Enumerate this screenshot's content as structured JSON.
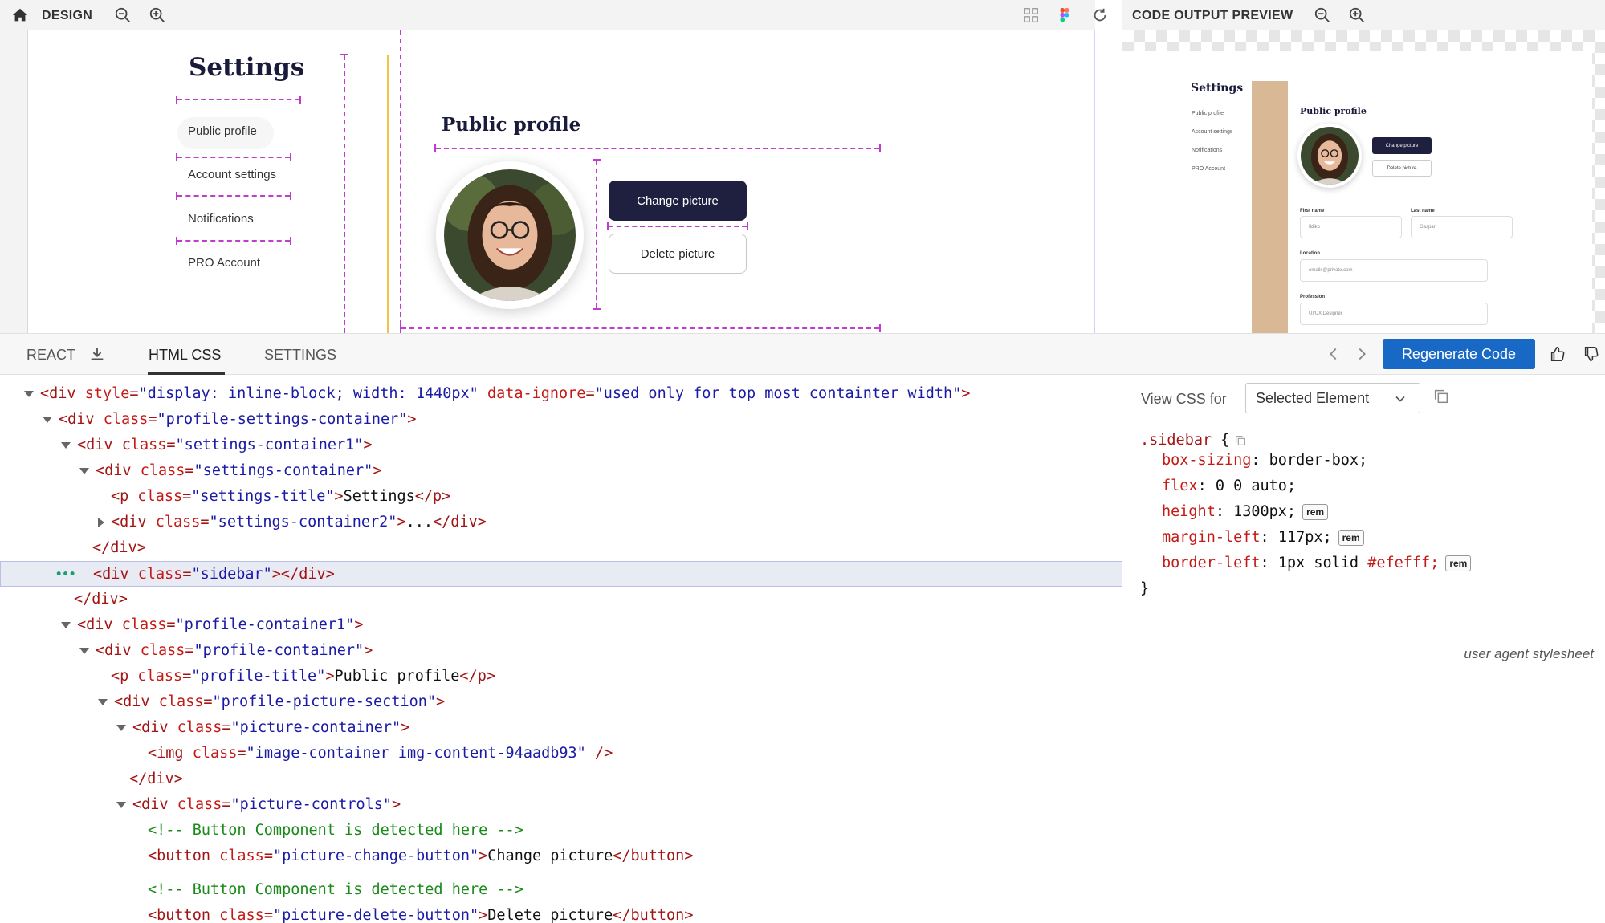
{
  "design_bar": {
    "label": "DESIGN"
  },
  "preview_bar": {
    "label": "CODE OUTPUT PREVIEW"
  },
  "canvas": {
    "settings_title": "Settings",
    "nav": [
      "Public profile",
      "Account settings",
      "Notifications",
      "PRO Account"
    ],
    "profile_title": "Public profile",
    "change_button": "Change picture",
    "delete_button": "Delete picture",
    "accent_line_color": "#f5c242",
    "guide_color": "#c03ccd",
    "button_primary_color": "#1f1f3f"
  },
  "preview": {
    "settings_title": "Settings",
    "nav": [
      "Public profile",
      "Account settings",
      "Notifications",
      "PRO Account"
    ],
    "profile_title": "Public profile",
    "change_button": "Change picture",
    "delete_button": "Delete picture",
    "first_name_label": "First name",
    "first_name_value": "Ildiko",
    "last_name_label": "Last name",
    "last_name_value": "Gaspar",
    "location_label": "Location",
    "location_value": "emails@private.com",
    "profession_label": "Profession",
    "profession_value": "UI/UX Designer",
    "sidebar_color": "#d8b895"
  },
  "tabs": {
    "react": "REACT",
    "html_css": "HTML CSS",
    "settings": "SETTINGS",
    "regenerate": "Regenerate Code",
    "regenerate_color": "#1868c6"
  },
  "code_lines": [
    {
      "indent": 0,
      "tri": "down",
      "parts": [
        [
          "tag",
          "<div "
        ],
        [
          "attr",
          "style"
        ],
        [
          "sym",
          "="
        ],
        [
          "val",
          "\"display: inline-block; width: 1440px\""
        ],
        [
          "txt",
          " "
        ],
        [
          "attr",
          "data-ignore"
        ],
        [
          "sym",
          "="
        ],
        [
          "val",
          "\"used only for top most containter width\""
        ],
        [
          "tag",
          ">"
        ]
      ]
    },
    {
      "indent": 1,
      "tri": "down",
      "parts": [
        [
          "tag",
          "<div "
        ],
        [
          "attr",
          "class"
        ],
        [
          "sym",
          "="
        ],
        [
          "val",
          "\"profile-settings-container\""
        ],
        [
          "tag",
          ">"
        ]
      ]
    },
    {
      "indent": 2,
      "tri": "down",
      "parts": [
        [
          "tag",
          "<div "
        ],
        [
          "attr",
          "class"
        ],
        [
          "sym",
          "="
        ],
        [
          "val",
          "\"settings-container1\""
        ],
        [
          "tag",
          ">"
        ]
      ]
    },
    {
      "indent": 3,
      "tri": "down",
      "parts": [
        [
          "tag",
          "<div "
        ],
        [
          "attr",
          "class"
        ],
        [
          "sym",
          "="
        ],
        [
          "val",
          "\"settings-container\""
        ],
        [
          "tag",
          ">"
        ]
      ]
    },
    {
      "indent": 4,
      "tri": "none",
      "parts": [
        [
          "tag",
          "<p "
        ],
        [
          "attr",
          "class"
        ],
        [
          "sym",
          "="
        ],
        [
          "val",
          "\"settings-title\""
        ],
        [
          "tag",
          ">"
        ],
        [
          "txt",
          "Settings"
        ],
        [
          "tag",
          "</p>"
        ]
      ]
    },
    {
      "indent": 4,
      "tri": "right",
      "parts": [
        [
          "tag",
          "<div "
        ],
        [
          "attr",
          "class"
        ],
        [
          "sym",
          "="
        ],
        [
          "val",
          "\"settings-container2\""
        ],
        [
          "tag",
          ">"
        ],
        [
          "txt",
          "..."
        ],
        [
          "tag",
          "</div>"
        ]
      ]
    },
    {
      "indent": 3,
      "tri": "none",
      "parts": [
        [
          "tag",
          "</div>"
        ]
      ]
    },
    {
      "indent": 3,
      "tri": "none",
      "sel": true,
      "parts": [
        [
          "tag",
          "<div "
        ],
        [
          "attr",
          "class"
        ],
        [
          "sym",
          "="
        ],
        [
          "val",
          "\"sidebar\""
        ],
        [
          "tag",
          "></div>"
        ]
      ]
    },
    {
      "indent": 2,
      "tri": "none",
      "parts": [
        [
          "tag",
          "</div>"
        ]
      ]
    },
    {
      "indent": 2,
      "tri": "down",
      "parts": [
        [
          "tag",
          "<div "
        ],
        [
          "attr",
          "class"
        ],
        [
          "sym",
          "="
        ],
        [
          "val",
          "\"profile-container1\""
        ],
        [
          "tag",
          ">"
        ]
      ]
    },
    {
      "indent": 3,
      "tri": "down",
      "parts": [
        [
          "tag",
          "<div "
        ],
        [
          "attr",
          "class"
        ],
        [
          "sym",
          "="
        ],
        [
          "val",
          "\"profile-container\""
        ],
        [
          "tag",
          ">"
        ]
      ]
    },
    {
      "indent": 4,
      "tri": "none",
      "parts": [
        [
          "tag",
          "<p "
        ],
        [
          "attr",
          "class"
        ],
        [
          "sym",
          "="
        ],
        [
          "val",
          "\"profile-title\""
        ],
        [
          "tag",
          ">"
        ],
        [
          "txt",
          "Public profile"
        ],
        [
          "tag",
          "</p>"
        ]
      ]
    },
    {
      "indent": 4,
      "tri": "down",
      "parts": [
        [
          "tag",
          "<div "
        ],
        [
          "attr",
          "class"
        ],
        [
          "sym",
          "="
        ],
        [
          "val",
          "\"profile-picture-section\""
        ],
        [
          "tag",
          ">"
        ]
      ]
    },
    {
      "indent": 5,
      "tri": "down",
      "parts": [
        [
          "tag",
          "<div "
        ],
        [
          "attr",
          "class"
        ],
        [
          "sym",
          "="
        ],
        [
          "val",
          "\"picture-container\""
        ],
        [
          "tag",
          ">"
        ]
      ]
    },
    {
      "indent": 6,
      "tri": "none",
      "parts": [
        [
          "tag",
          "<img "
        ],
        [
          "attr",
          "class"
        ],
        [
          "sym",
          "="
        ],
        [
          "val",
          "\"image-container img-content-94aadb93\""
        ],
        [
          "tag",
          " />"
        ]
      ]
    },
    {
      "indent": 5,
      "tri": "none",
      "parts": [
        [
          "tag",
          "</div>"
        ]
      ]
    },
    {
      "indent": 5,
      "tri": "down",
      "parts": [
        [
          "tag",
          "<div "
        ],
        [
          "attr",
          "class"
        ],
        [
          "sym",
          "="
        ],
        [
          "val",
          "\"picture-controls\""
        ],
        [
          "tag",
          ">"
        ]
      ]
    },
    {
      "indent": 6,
      "tri": "none",
      "parts": [
        [
          "com",
          "<!-- Button Component is detected here -->"
        ]
      ]
    },
    {
      "indent": 6,
      "tri": "none",
      "parts": [
        [
          "tag",
          "<button "
        ],
        [
          "attr",
          "class"
        ],
        [
          "sym",
          "="
        ],
        [
          "val",
          "\"picture-change-button\""
        ],
        [
          "tag",
          ">"
        ],
        [
          "txt",
          "Change picture"
        ],
        [
          "tag",
          "</button>"
        ]
      ]
    },
    {
      "indent": 6,
      "tri": "none",
      "gap": true,
      "parts": [
        [
          "com",
          "<!-- Button Component is detected here -->"
        ]
      ]
    },
    {
      "indent": 6,
      "tri": "none",
      "parts": [
        [
          "tag",
          "<button "
        ],
        [
          "attr",
          "class"
        ],
        [
          "sym",
          "="
        ],
        [
          "val",
          "\"picture-delete-button\""
        ],
        [
          "tag",
          ">"
        ],
        [
          "txt",
          "Delete picture"
        ],
        [
          "tag",
          "</button>"
        ]
      ]
    }
  ],
  "css_panel": {
    "view_label": "View CSS for",
    "select_value": "Selected Element",
    "selector": ".sidebar",
    "rules": [
      {
        "prop": "box-sizing",
        "value": "border-box;",
        "rem": false,
        "color": ""
      },
      {
        "prop": "flex",
        "value": "0 0 auto;",
        "rem": false,
        "color": ""
      },
      {
        "prop": "height",
        "value": "1300px;",
        "rem": true,
        "color": ""
      },
      {
        "prop": "margin-left",
        "value": "117px;",
        "rem": true,
        "color": ""
      },
      {
        "prop": "border-left",
        "value": "1px solid ",
        "rem": true,
        "color": "#efefff;"
      }
    ],
    "rem_label": "rem",
    "ua_label": "user agent stylesheet"
  }
}
